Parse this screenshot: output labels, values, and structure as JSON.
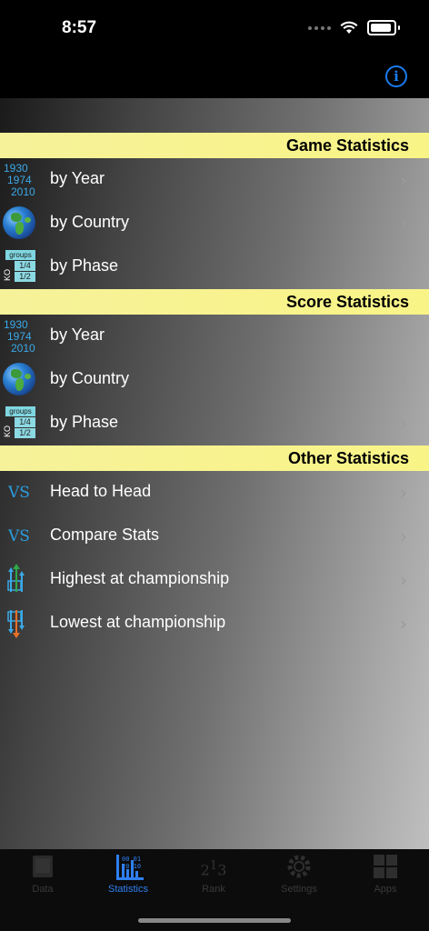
{
  "status": {
    "time": "8:57"
  },
  "sections": [
    {
      "title": "Game Statistics",
      "items": [
        {
          "label": "by Year",
          "icon": "year-range-icon"
        },
        {
          "label": "by Country",
          "icon": "globe-icon"
        },
        {
          "label": "by Phase",
          "icon": "phase-icon"
        }
      ]
    },
    {
      "title": "Score Statistics",
      "items": [
        {
          "label": "by Year",
          "icon": "year-range-icon"
        },
        {
          "label": "by Country",
          "icon": "globe-icon"
        },
        {
          "label": "by Phase",
          "icon": "phase-icon"
        }
      ]
    },
    {
      "title": "Other Statistics",
      "items": [
        {
          "label": "Head to Head",
          "icon": "vs-icon"
        },
        {
          "label": "Compare Stats",
          "icon": "vs-icon"
        },
        {
          "label": "Highest at championship",
          "icon": "arrows-up-icon"
        },
        {
          "label": "Lowest at championship",
          "icon": "arrows-down-icon"
        }
      ]
    }
  ],
  "icon_text": {
    "years": [
      "1930",
      "1974",
      "2010"
    ],
    "phase_groups": "groups",
    "phase_quarter": "1/4",
    "phase_semi": "1/2",
    "phase_ko": "KO",
    "vs": "VS"
  },
  "tabs": [
    {
      "label": "Data",
      "active": false
    },
    {
      "label": "Statistics",
      "active": true
    },
    {
      "label": "Rank",
      "active": false
    },
    {
      "label": "Settings",
      "active": false
    },
    {
      "label": "Apps",
      "active": false
    }
  ],
  "colors": {
    "accent": "#2f7ff2",
    "section_header": "#f6f29a"
  }
}
